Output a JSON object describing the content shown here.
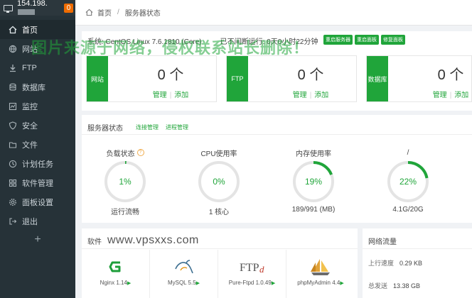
{
  "server": {
    "ip": "154.198.",
    "badge": "0"
  },
  "sidebar": {
    "items": [
      {
        "label": "首页",
        "icon": "home-icon",
        "active": true
      },
      {
        "label": "网站",
        "icon": "globe-icon"
      },
      {
        "label": "FTP",
        "icon": "ftp-icon"
      },
      {
        "label": "数据库",
        "icon": "database-icon"
      },
      {
        "label": "监控",
        "icon": "monitor-icon"
      },
      {
        "label": "安全",
        "icon": "shield-icon"
      },
      {
        "label": "文件",
        "icon": "folder-icon"
      },
      {
        "label": "计划任务",
        "icon": "clock-icon"
      },
      {
        "label": "软件管理",
        "icon": "grid-icon"
      },
      {
        "label": "面板设置",
        "icon": "gear-icon"
      },
      {
        "label": "退出",
        "icon": "logout-icon"
      }
    ],
    "add_label": "+"
  },
  "breadcrumb": {
    "home": "首页",
    "separator": "/",
    "current": "服务器状态"
  },
  "system": {
    "os": "系统: CentOS Linux 7.6.1810 (Core)",
    "uptime": "已不间断运行: 0天0小时22分钟",
    "buttons": [
      "重启服务器",
      "重启面板",
      "修复面板"
    ]
  },
  "cards": [
    {
      "tag": "网站",
      "count": "0 个",
      "manage": "管理",
      "add": "添加"
    },
    {
      "tag": "FTP",
      "count": "0 个",
      "manage": "管理",
      "add": "添加"
    },
    {
      "tag": "数据库",
      "count": "0 个",
      "manage": "管理",
      "add": "添加"
    }
  ],
  "status": {
    "title": "服务器状态",
    "tabs": [
      "连接管理",
      "进程管理"
    ],
    "gauges": [
      {
        "title": "负载状态",
        "help": "?",
        "value_text": "1%",
        "percent": 1,
        "bottom": "运行流畅"
      },
      {
        "title": "CPU使用率",
        "value_text": "0%",
        "percent": 0,
        "bottom": "1 核心"
      },
      {
        "title": "内存使用率",
        "value_text": "19%",
        "percent": 19,
        "bottom": "189/991 (MB)"
      },
      {
        "title": "/",
        "value_text": "22%",
        "percent": 22,
        "bottom": "4.1G/20G"
      }
    ],
    "accent": "#20a53a"
  },
  "software": {
    "title": "软件",
    "site_text": "www.vpsxxs.com",
    "items": [
      {
        "name": "Nginx 1.14",
        "icon": "nginx-icon"
      },
      {
        "name": "MySQL 5.5",
        "icon": "mysql-icon"
      },
      {
        "name": "Pure-Ftpd 1.0.49",
        "icon": "ftp-logo-icon"
      },
      {
        "name": "phpMyAdmin 4.4",
        "icon": "phpmyadmin-icon"
      }
    ],
    "arrow": "▶"
  },
  "network": {
    "title": "网络流量",
    "up_label": "上行速度",
    "up_value": "0.29 KB",
    "total_label": "总发送",
    "total_value": "13.38 GB"
  },
  "watermark": "图片来源于网络，侵权联系站长删除！"
}
